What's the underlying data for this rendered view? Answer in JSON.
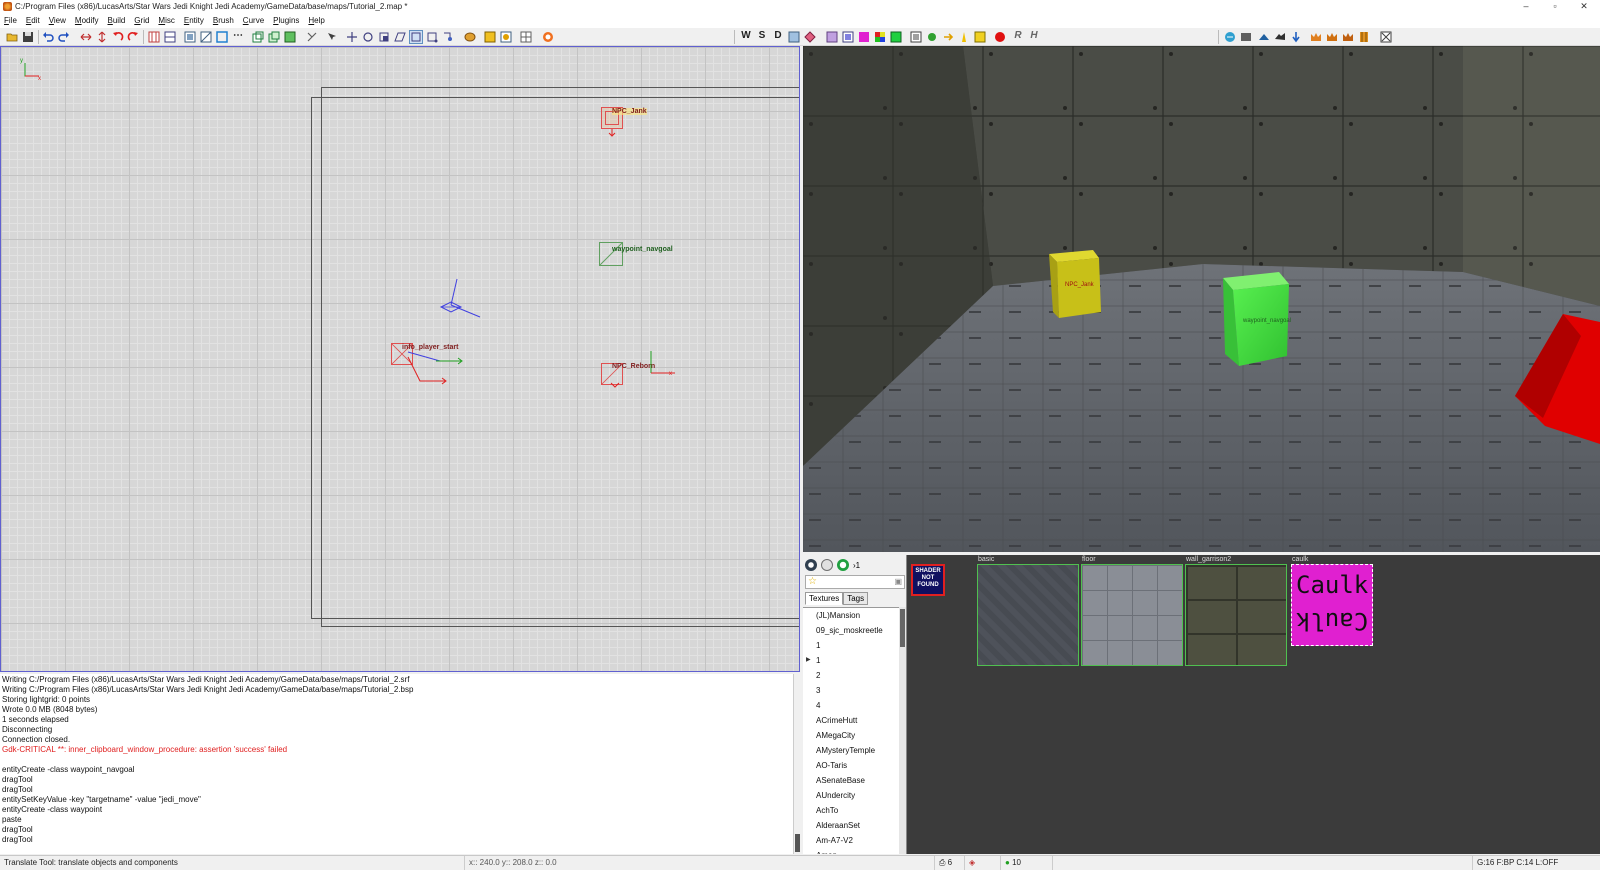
{
  "window": {
    "title": "C:/Program Files (x86)/LucasArts/Star Wars Jedi Knight Jedi Academy/GameData/base/maps/Tutorial_2.map *",
    "minimize": "–",
    "maximize": "▫",
    "close": "✕"
  },
  "menu": [
    "File",
    "Edit",
    "View",
    "Modify",
    "Build",
    "Grid",
    "Misc",
    "Entity",
    "Brush",
    "Curve",
    "Plugins",
    "Help"
  ],
  "toolbar": {
    "w_label": "W",
    "s_label": "S",
    "d_label": "D",
    "r_label": "R",
    "h_label": "H"
  },
  "grid_view": {
    "axis_y": "y",
    "axis_x": "x",
    "entities": {
      "npc_jank": "NPC_Jank",
      "waypoint_navgoal": "waypoint_navgoal",
      "info_player_start": "info_player_start",
      "npc_reborn": "NPC_Reborn"
    },
    "colors": {
      "npc": "#e02020",
      "waypoint": "#20a020",
      "selection": "#4040e0",
      "grid": "#d7d7d7"
    }
  },
  "camera_view": {
    "label_jank": "NPC_Jank",
    "label_waypoint": "waypoint_navgoal",
    "colors": {
      "yellow_block": "#c8c018",
      "green_block": "#40e040",
      "red_block": "#e00000"
    }
  },
  "console": {
    "lines": [
      {
        "text": "Writing C:/Program Files (x86)/LucasArts/Star Wars Jedi Knight Jedi Academy/GameData/base/maps/Tutorial_2.srf"
      },
      {
        "text": "Writing C:/Program Files (x86)/LucasArts/Star Wars Jedi Knight Jedi Academy/GameData/base/maps/Tutorial_2.bsp"
      },
      {
        "text": "Storing lightgrid: 0 points"
      },
      {
        "text": "Wrote 0.0 MB (8048 bytes)"
      },
      {
        "text": "      1 seconds elapsed"
      },
      {
        "text": "Disconnecting"
      },
      {
        "text": "Connection closed."
      },
      {
        "text": "Gdk-CRITICAL **: inner_clipboard_window_procedure: assertion 'success' failed",
        "error": true
      },
      {
        "text": ""
      },
      {
        "text": "entityCreate -class waypoint_navgoal"
      },
      {
        "text": "dragTool"
      },
      {
        "text": "dragTool"
      },
      {
        "text": "entitySetKeyValue -key \"targetname\" -value \"jedi_move\""
      },
      {
        "text": "entityCreate -class waypoint"
      },
      {
        "text": "paste"
      },
      {
        "text": "dragTool"
      },
      {
        "text": "dragTool"
      }
    ]
  },
  "texture_browser": {
    "tabs": [
      "Textures",
      "Tags"
    ],
    "tree": [
      {
        "label": "(JL)Mansion"
      },
      {
        "label": "09_sjc_moskreetle"
      },
      {
        "label": "1"
      },
      {
        "label": "1",
        "expandable": true
      },
      {
        "label": "2"
      },
      {
        "label": "3"
      },
      {
        "label": "4"
      },
      {
        "label": "ACrimeHutt"
      },
      {
        "label": "AMegaCity"
      },
      {
        "label": "AMysteryTemple"
      },
      {
        "label": "AO-Taris"
      },
      {
        "label": "ASenateBase"
      },
      {
        "label": "AUndercity"
      },
      {
        "label": "AchTo"
      },
      {
        "label": "AlderaanSet"
      },
      {
        "label": "Am-A7-V2"
      },
      {
        "label": "Amon"
      }
    ],
    "shader_notfound": [
      "SHADER",
      "NOT",
      "FOUND"
    ],
    "textures": {
      "basic": "basic",
      "floor": "floor",
      "wall": "wall_garrison2",
      "caulk": "caulk"
    },
    "caulk_text": "Caulk",
    "colors": {
      "caulk": "#e020d0",
      "tile_border": "#50c050",
      "bg": "#3b3b3b"
    }
  },
  "statusbar": {
    "tool_hint": "Translate Tool: translate objects and components",
    "coords": "x:: 240.0  y:: 208.0  z::   0.0",
    "brushes": "6",
    "entities_count": "10",
    "grid_info": "G:16  F:BP  C:14  L:OFF"
  }
}
